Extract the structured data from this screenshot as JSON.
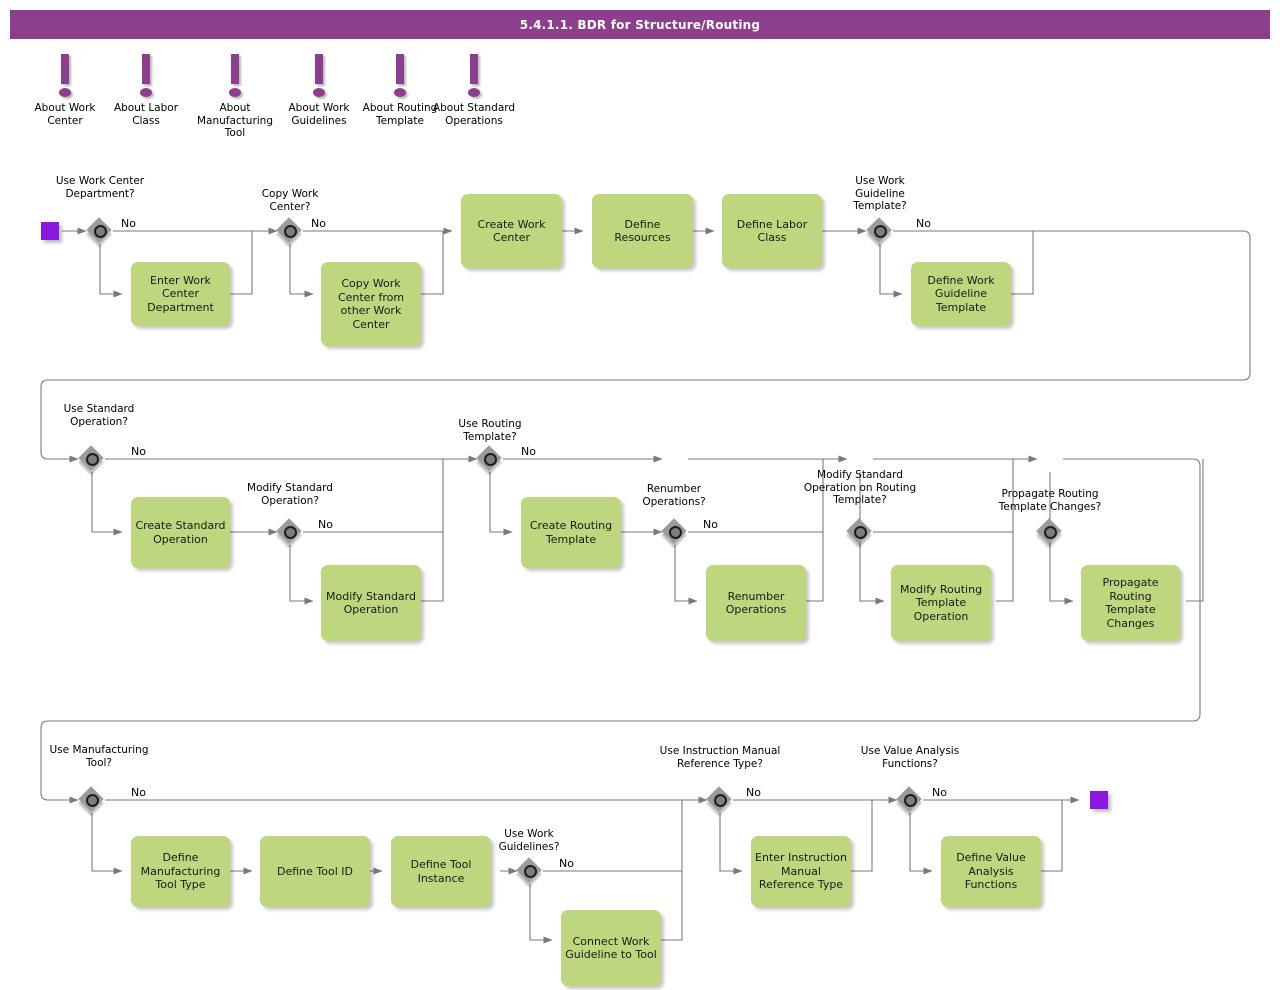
{
  "title": "5.4.1.1. BDR for Structure/Routing",
  "colors": {
    "title_bar": "#8c3f8c",
    "task_fill": "#bed67e",
    "gateway_fill": "#9b9b9b",
    "marker": "#8b18e0",
    "connector": "#7a7a7a"
  },
  "notes": [
    {
      "label": "About Work Center"
    },
    {
      "label": "About Labor Class"
    },
    {
      "label": "About Manufacturing Tool"
    },
    {
      "label": "About Work Guidelines"
    },
    {
      "label": "About Routing Template"
    },
    {
      "label": "About Standard Operations"
    }
  ],
  "edge_labels": {
    "no": "No"
  },
  "rows": [
    {
      "name": "row-1",
      "gateways": [
        {
          "label": "Use Work Center Department?"
        },
        {
          "label": "Copy Work Center?"
        },
        {
          "label": "Use Work Guideline Template?"
        }
      ],
      "tasks": [
        {
          "label": "Enter Work Center Department"
        },
        {
          "label": "Copy Work Center from other Work Center"
        },
        {
          "label": "Create Work Center"
        },
        {
          "label": "Define Resources"
        },
        {
          "label": "Define Labor Class"
        },
        {
          "label": "Define Work Guideline Template"
        }
      ]
    },
    {
      "name": "row-2",
      "gateways": [
        {
          "label": "Use Standard Operation?"
        },
        {
          "label": "Modify Standard Operation?"
        },
        {
          "label": "Use Routing Template?"
        },
        {
          "label": "Renumber Operations?"
        },
        {
          "label": "Modify Standard Operation on Routing Template?"
        },
        {
          "label": "Propagate Routing Template Changes?"
        }
      ],
      "tasks": [
        {
          "label": "Create Standard Operation"
        },
        {
          "label": "Modify Standard Operation"
        },
        {
          "label": "Create Routing Template"
        },
        {
          "label": "Renumber Operations"
        },
        {
          "label": "Modify Routing Template Operation"
        },
        {
          "label": "Propagate Routing Template Changes"
        }
      ]
    },
    {
      "name": "row-3",
      "gateways": [
        {
          "label": "Use Manufacturing Tool?"
        },
        {
          "label": "Use Work Guidelines?"
        },
        {
          "label": "Use Instruction Manual Reference Type?"
        },
        {
          "label": "Use Value Analysis Functions?"
        }
      ],
      "tasks": [
        {
          "label": "Define Manufacturing Tool Type"
        },
        {
          "label": "Define Tool ID"
        },
        {
          "label": "Define Tool Instance"
        },
        {
          "label": "Connect Work Guideline to Tool"
        },
        {
          "label": "Enter Instruction Manual Reference Type"
        },
        {
          "label": "Define Value Analysis Functions"
        }
      ]
    }
  ],
  "markers": {
    "start": "start-event",
    "end": "end-event"
  }
}
